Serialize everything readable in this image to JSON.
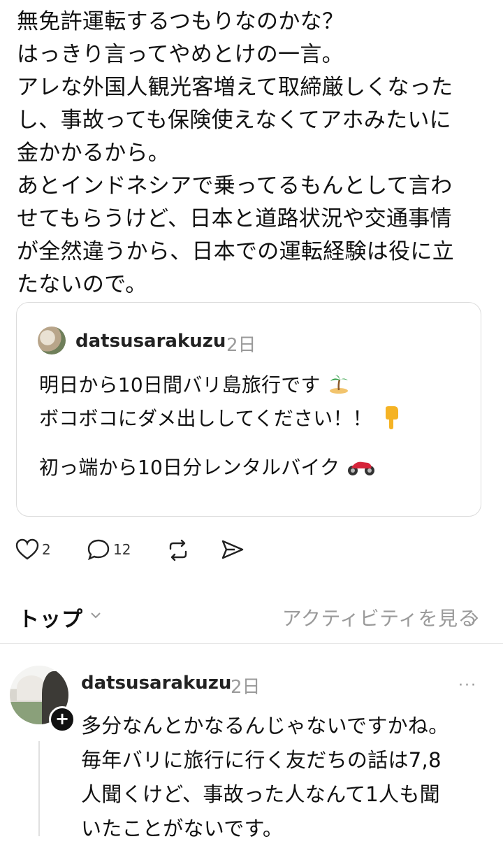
{
  "post": {
    "lines": [
      "無免許運転するつもりなのかな？",
      "はっきり言ってやめとけの一言。",
      "アレな外国人観光客増えて取締厳しくなった",
      "し、事故っても保険使えなくてアホみたいに",
      "金かかるから。",
      "あとインドネシアで乗ってるもんとして言わ",
      "せてもらうけど、日本と道路状況や交通事情",
      "が全然違うから、日本での運転経験は役に立",
      "たないので。"
    ]
  },
  "quoted": {
    "username": "datsusarakuzu",
    "time": "2日",
    "line1": "明日から10日間バリ島旅行です",
    "line2": "ボコボコにダメ出ししてください！！",
    "line3": "初っ端から10日分レンタルバイク",
    "emoji1": "palm-island-emoji",
    "emoji2": "pointing-down-emoji",
    "emoji3": "motorcycle-emoji"
  },
  "actions": {
    "likes": "2",
    "replies": "12"
  },
  "tabs": {
    "top": "トップ",
    "activity": "アクティビティを見る"
  },
  "reply": {
    "username": "datsusarakuzu",
    "time": "2日",
    "more": "···",
    "lines": [
      "多分なんとかなるんじゃないですかね。",
      "毎年バリに旅行に行く友だちの話は7,8",
      "人聞くけど、事故った人なんて1人も聞",
      "いたことがないです。"
    ]
  },
  "colors": {
    "text": "#111111",
    "muted": "#9a9a9a",
    "border": "#dcdcdc"
  }
}
